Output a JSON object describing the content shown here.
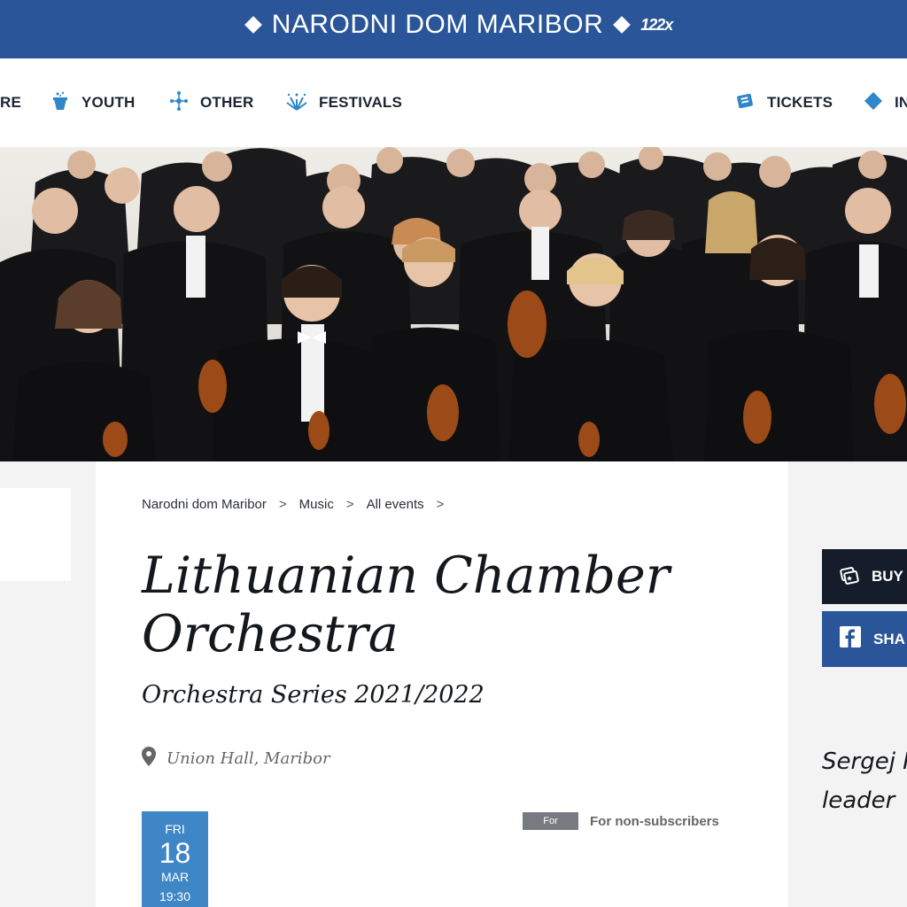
{
  "header": {
    "title": "NARODNI DOM MARIBOR",
    "anniversary": "122x",
    "brand_color": "#2a5699"
  },
  "nav": {
    "items": [
      {
        "label": "RE",
        "icon": "theatre-icon"
      },
      {
        "label": "YOUTH",
        "icon": "magic-hat-icon"
      },
      {
        "label": "OTHER",
        "icon": "network-icon"
      },
      {
        "label": "FESTIVALS",
        "icon": "fireworks-icon"
      },
      {
        "label": "TICKETS",
        "icon": "tickets-icon"
      },
      {
        "label": "IN",
        "icon": "diamond-icon"
      }
    ],
    "accent_color": "#2f86c8"
  },
  "hero": {
    "image": "orchestra-group-photo"
  },
  "breadcrumb": [
    "Narodni dom Maribor",
    "Music",
    "All events",
    ""
  ],
  "event": {
    "title": "Lithuanian Chamber Orchestra",
    "subtitle": "Orchestra Series 2021/2022",
    "venue": "Union Hall, Maribor",
    "date": {
      "weekday": "FRI",
      "day": "18",
      "month": "MAR",
      "time": "19:30"
    },
    "for_badge": "For",
    "for_label": "For non-subscribers"
  },
  "actions": {
    "buy_label": "BUY",
    "share_label": "SHA"
  },
  "conductor": {
    "name": "Sergej K",
    "role": "leader"
  }
}
